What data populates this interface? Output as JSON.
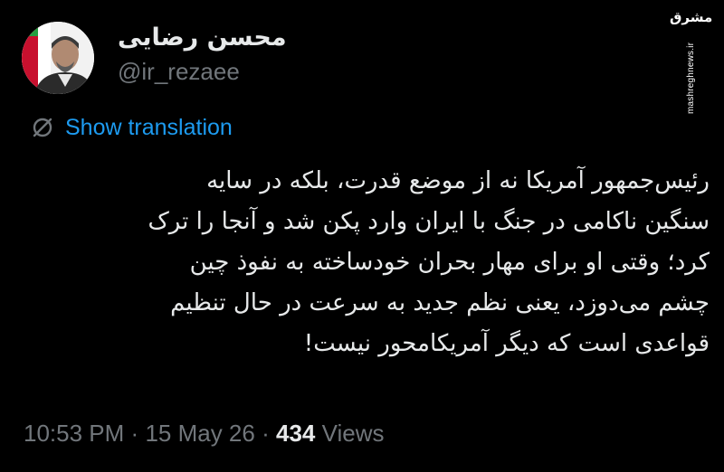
{
  "profile": {
    "display_name": "محسن رضایی",
    "handle": "@ir_rezaee"
  },
  "translation": {
    "icon": "globe-slash-icon",
    "label": "Show translation"
  },
  "tweet": {
    "lines": [
      "رئیس‌جمهور آمریکا نه از موضع قدرت، بلکه در سایه",
      "سنگین ناکامی در جنگ با ایران وارد پکن شد و آنجا را ترک",
      "کرد؛ وقتی او برای مهار بحران خودساخته به نفوذ چین",
      "چشم می‌دوزد، یعنی نظم جدید به سرعت در حال تنظیم",
      "قواعدی است که دیگر آمریکامحور نیست!"
    ]
  },
  "meta": {
    "time": "10:53 PM",
    "separator": "·",
    "date": "15 May 26",
    "views_count": "434",
    "views_label": "Views"
  },
  "watermark": {
    "logo": "مشرق",
    "url": "mashreghnews.ir"
  },
  "colors": {
    "background": "#000000",
    "text": "#e7e9ea",
    "secondary": "#71767b",
    "accent": "#1d9bf0"
  }
}
